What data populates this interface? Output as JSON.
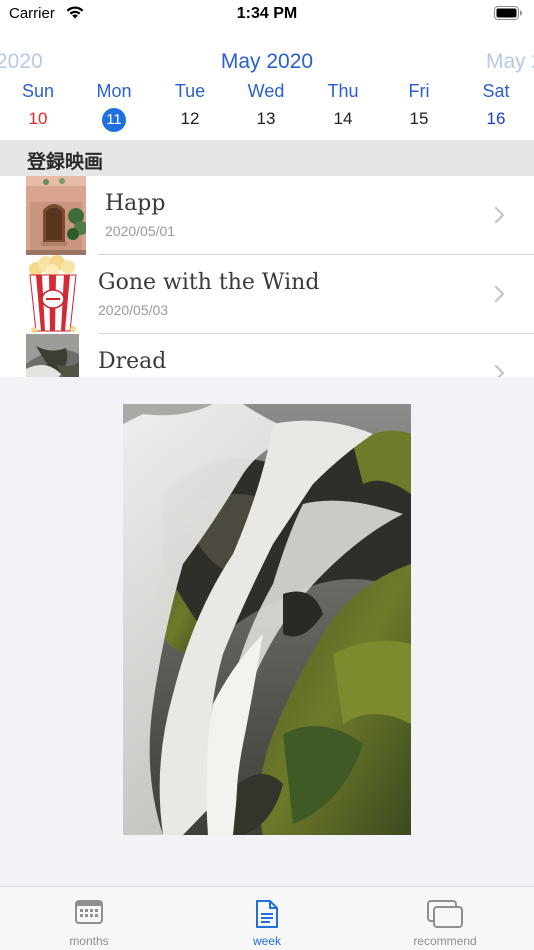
{
  "status_bar": {
    "carrier": "Carrier",
    "time": "1:34 PM"
  },
  "calendar": {
    "prev_month": "2020",
    "current_month": "May 2020",
    "next_month": "May 2",
    "weekdays": [
      "Sun",
      "Mon",
      "Tue",
      "Wed",
      "Thu",
      "Fri",
      "Sat"
    ],
    "days": [
      "10",
      "11",
      "12",
      "13",
      "14",
      "15",
      "16"
    ],
    "selected_day": "11",
    "colors": {
      "accent": "#2a5fd3",
      "today_circle": "#1f6fe0",
      "sunday": "#e8242a",
      "saturday": "#1a3cd0"
    }
  },
  "section": {
    "title": "登録映画"
  },
  "movies": [
    {
      "title": "Happ",
      "date": "2020/05/01",
      "thumb": "door-photo"
    },
    {
      "title": "Gone with the Wind",
      "date": "2020/05/03",
      "thumb": "popcorn-illustration"
    },
    {
      "title": "Dread",
      "date": "",
      "thumb": "waterfall-photo"
    }
  ],
  "featured": {
    "image": "waterfall-over-mossy-rocks"
  },
  "tabs": [
    {
      "label": "months",
      "icon": "calendar-icon",
      "active": false
    },
    {
      "label": "week",
      "icon": "document-icon",
      "active": true
    },
    {
      "label": "recommend",
      "icon": "cards-icon",
      "active": false
    }
  ]
}
